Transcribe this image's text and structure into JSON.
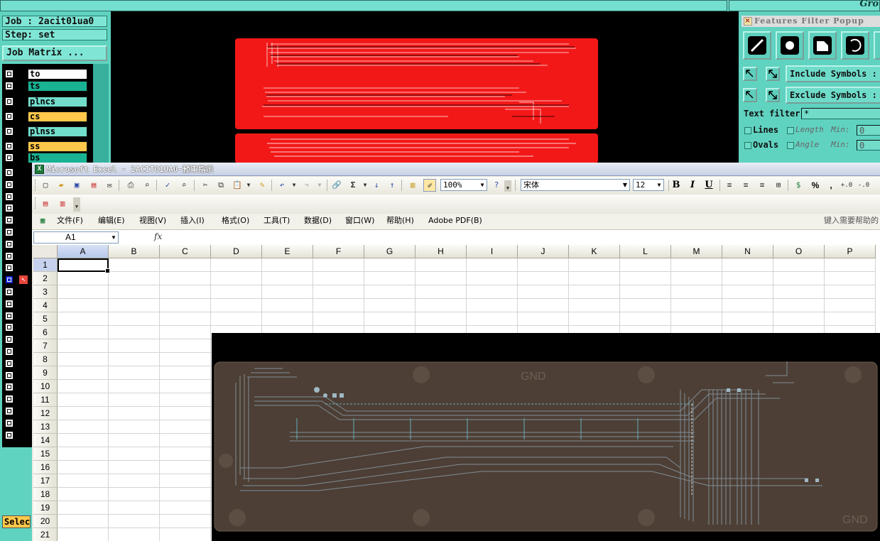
{
  "cam": {
    "job_label": "Job : 2acit01ua0",
    "step_label": "Step: set",
    "job_matrix_button": "Job Matrix ...",
    "group_label": "Gro",
    "layers": [
      {
        "name": "to",
        "color": "#ffffff"
      },
      {
        "name": "ts",
        "color": "#19b394"
      },
      {
        "name": "plncs",
        "color": "#73ddcc"
      },
      {
        "name": "cs",
        "color": "#ffc84a"
      },
      {
        "name": "plnss",
        "color": "#73ddcc"
      },
      {
        "name": "ss",
        "color": "#ffc84a"
      },
      {
        "name": "bs",
        "color": "#19b394"
      }
    ],
    "select_button": "Selec",
    "features_filter": {
      "title": "Features Filter Popup",
      "include_symbols": "Include Symbols :",
      "exclude_symbols": "Exclude Symbols :",
      "text_filter_label": "Text filter",
      "text_filter_value": "*",
      "lines_label": "Lines",
      "ovals_label": "Ovals",
      "length_label": "Length",
      "angle_label": "Angle",
      "min_label": "Min:",
      "length_min": "0",
      "angle_min": "0"
    }
  },
  "excel": {
    "title": "Microsoft Excel - 2ACIT01UA0-预审指示",
    "zoom": "100%",
    "font_name": "宋体",
    "font_size": "12",
    "bold": "B",
    "italic": "I",
    "underline": "U",
    "percent": "%",
    "comma": ",",
    "menu": [
      {
        "label": "文件(F)"
      },
      {
        "label": "编辑(E)"
      },
      {
        "label": "视图(V)"
      },
      {
        "label": "插入(I)"
      },
      {
        "label": "格式(O)"
      },
      {
        "label": "工具(T)"
      },
      {
        "label": "数据(D)"
      },
      {
        "label": "窗口(W)"
      },
      {
        "label": "帮助(H)"
      },
      {
        "label": "Adobe PDF(B)"
      }
    ],
    "help_placeholder": "键入需要帮助的",
    "name_box": "A1",
    "fx": "fx",
    "columns": [
      "A",
      "B",
      "C",
      "D",
      "E",
      "F",
      "G",
      "H",
      "I",
      "J",
      "K",
      "L",
      "M",
      "N",
      "O",
      "P"
    ],
    "rows": [
      "1",
      "2",
      "3",
      "4",
      "5",
      "6",
      "7",
      "8",
      "9",
      "10",
      "11",
      "12",
      "13",
      "14",
      "15",
      "16",
      "17",
      "18",
      "19",
      "20",
      "21"
    ],
    "selected_cell": "A1"
  },
  "pcb_image": {
    "gnd_label_top": "GND",
    "gnd_label_bottom": "GND"
  }
}
